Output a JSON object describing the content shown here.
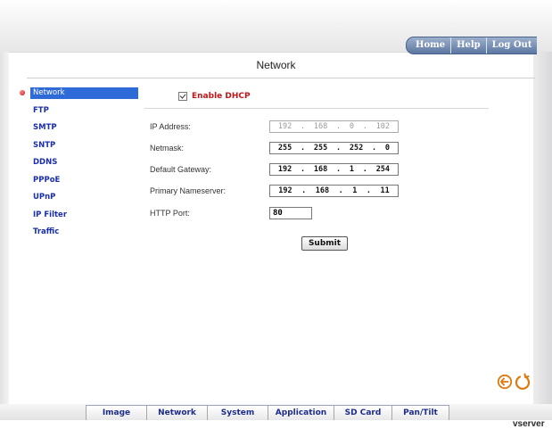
{
  "header": {
    "tabs": [
      "Home",
      "Help",
      "Log Out"
    ]
  },
  "page": {
    "title": "Network"
  },
  "sidebar": {
    "items": [
      {
        "label": "Network",
        "active": true
      },
      {
        "label": "FTP"
      },
      {
        "label": "SMTP"
      },
      {
        "label": "SNTP"
      },
      {
        "label": "DDNS"
      },
      {
        "label": "PPPoE"
      },
      {
        "label": "UPnP"
      },
      {
        "label": "IP Filter"
      },
      {
        "label": "Traffic"
      }
    ]
  },
  "form": {
    "dhcp_label": "Enable DHCP",
    "dhcp_checked": true,
    "ip_address": {
      "label": "IP Address:",
      "octets": [
        "192",
        "168",
        "0",
        "102"
      ]
    },
    "netmask": {
      "label": "Netmask:",
      "octets": [
        "255",
        "255",
        "252",
        "0"
      ]
    },
    "gateway": {
      "label": "Default Gateway:",
      "octets": [
        "192",
        "168",
        "1",
        "254"
      ]
    },
    "nameserver": {
      "label": "Primary Nameserver:",
      "octets": [
        "192",
        "168",
        "1",
        "11"
      ]
    },
    "http_port": {
      "label": "HTTP Port:",
      "value": "80"
    },
    "submit_label": "Submit"
  },
  "bottom_nav": {
    "tabs": [
      "Image",
      "Network",
      "System",
      "Application",
      "SD Card",
      "Pan/Tilt"
    ]
  },
  "brand": "vserver",
  "icons": {
    "back": "back-arrow-icon",
    "reload": "reload-icon"
  },
  "colors": {
    "accent": "#2f6bd8",
    "link": "#1a2eae",
    "dhcp_label": "#c0161a",
    "tab_blue": "#5c76a0"
  }
}
